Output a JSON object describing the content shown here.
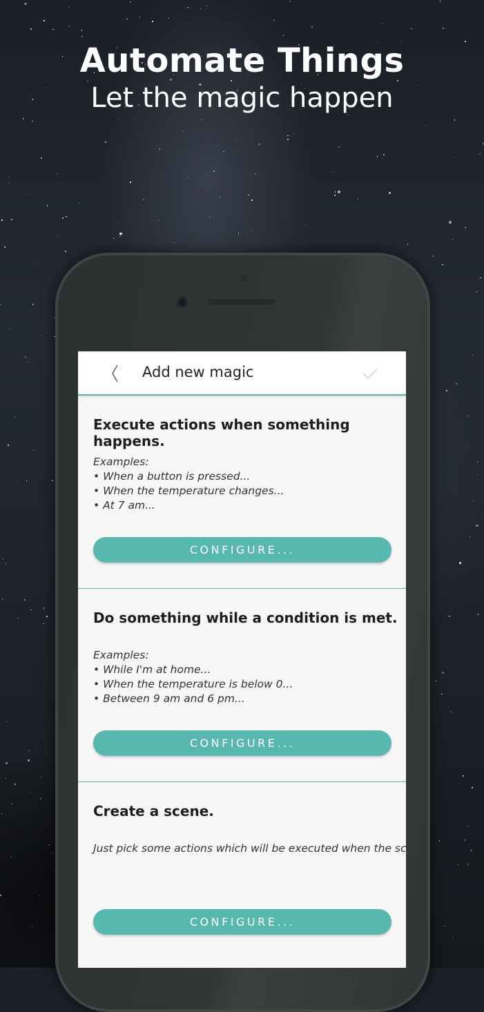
{
  "hero": {
    "title": "Automate Things",
    "subtitle": "Let the magic happen"
  },
  "appbar": {
    "back_icon": "chevron-left-icon",
    "title": "Add new magic",
    "confirm_icon": "checkmark-icon"
  },
  "colors": {
    "accent": "#57b8ad",
    "screen_bg": "#f7f7f7"
  },
  "cards": [
    {
      "title": "Execute actions when something happens.",
      "lines": [
        "Examples:",
        "• When a button is pressed...",
        "• When the temperature changes...",
        "• At 7 am..."
      ],
      "button": "CONFIGURE..."
    },
    {
      "title": "Do something while a condition is met.",
      "lines": [
        "Examples:",
        "• While I'm at home...",
        "• When the temperature is below 0...",
        "• Between 9 am and 6 pm..."
      ],
      "button": "CONFIGURE..."
    },
    {
      "title": "Create a scene.",
      "description": "Just pick some actions which will be executed when the scene is activated. Scenes are like any other magic except they can also be activated manually.",
      "button": "CONFIGURE..."
    }
  ]
}
